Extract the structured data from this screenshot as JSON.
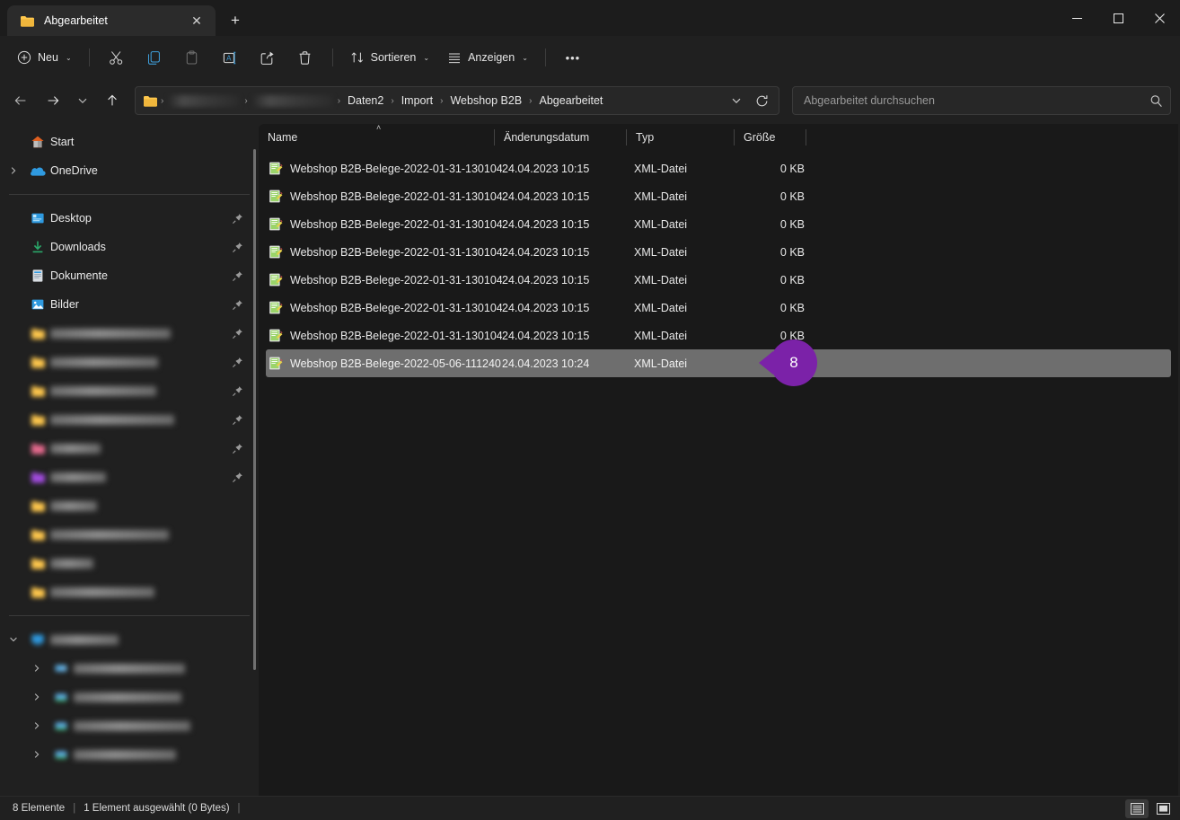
{
  "window": {
    "title": "Abgearbeitet",
    "controls": {
      "minimize": "minimize-icon",
      "maximize": "maximize-icon",
      "close": "close-icon"
    }
  },
  "tab": {
    "label": "Abgearbeitet",
    "close_label": "✕",
    "new_tab_label": "+"
  },
  "toolbar": {
    "new_label": "Neu",
    "sort_label": "Sortieren",
    "view_label": "Anzeigen",
    "more_label": "•••",
    "cut_name": "cut-icon",
    "copy_name": "copy-icon",
    "paste_name": "paste-icon",
    "rename_name": "rename-icon",
    "share_name": "share-icon",
    "delete_name": "delete-icon",
    "caret": "⌄"
  },
  "address": {
    "crumbs": [
      {
        "label": "",
        "redacted": true
      },
      {
        "label": "",
        "redacted": true
      },
      {
        "label": "Daten2",
        "redacted": false
      },
      {
        "label": "Import",
        "redacted": false
      },
      {
        "label": "Webshop B2B",
        "redacted": false
      },
      {
        "label": "Abgearbeitet",
        "redacted": false
      }
    ],
    "separator": "›",
    "dropdown_caret": "⌄",
    "refresh_name": "refresh-icon"
  },
  "search": {
    "placeholder": "Abgearbeitet durchsuchen",
    "value": ""
  },
  "sidebar": {
    "items": [
      {
        "label": "Start",
        "icon": "home-icon",
        "chevron": false,
        "pin": false,
        "redacted": false,
        "indent": 0
      },
      {
        "label": "OneDrive",
        "icon": "onedrive-icon",
        "chevron": true,
        "pin": false,
        "redacted": false,
        "indent": 0
      },
      {
        "divider": true
      },
      {
        "label": "Desktop",
        "icon": "desktop-icon",
        "chevron": false,
        "pin": true,
        "redacted": false,
        "indent": 0
      },
      {
        "label": "Downloads",
        "icon": "download-icon",
        "chevron": false,
        "pin": true,
        "redacted": false,
        "indent": 0
      },
      {
        "label": "Dokumente",
        "icon": "documents-icon",
        "chevron": false,
        "pin": true,
        "redacted": false,
        "indent": 0
      },
      {
        "label": "Bilder",
        "icon": "pictures-icon",
        "chevron": false,
        "pin": true,
        "redacted": false,
        "indent": 0
      },
      {
        "label": "",
        "icon": "folder-icon",
        "chevron": false,
        "pin": true,
        "redacted": true,
        "width": 134,
        "indent": 0
      },
      {
        "label": "",
        "icon": "folder-icon",
        "chevron": false,
        "pin": true,
        "redacted": true,
        "width": 120,
        "indent": 0
      },
      {
        "label": "",
        "icon": "folder-icon",
        "chevron": false,
        "pin": true,
        "redacted": true,
        "width": 118,
        "indent": 0
      },
      {
        "label": "",
        "icon": "folder-icon",
        "chevron": false,
        "pin": true,
        "redacted": true,
        "width": 138,
        "indent": 0
      },
      {
        "label": "",
        "icon": "pink-folder-icon",
        "chevron": false,
        "pin": true,
        "redacted": true,
        "width": 56,
        "indent": 0
      },
      {
        "label": "",
        "icon": "purple-folder-icon",
        "chevron": false,
        "pin": true,
        "redacted": true,
        "width": 62,
        "indent": 0
      },
      {
        "label": "",
        "icon": "folder-icon",
        "chevron": false,
        "pin": false,
        "redacted": true,
        "width": 52,
        "indent": 0
      },
      {
        "label": "",
        "icon": "folder-icon",
        "chevron": false,
        "pin": false,
        "redacted": true,
        "width": 132,
        "indent": 0
      },
      {
        "label": "",
        "icon": "folder-icon",
        "chevron": false,
        "pin": false,
        "redacted": true,
        "width": 48,
        "indent": 0
      },
      {
        "label": "",
        "icon": "folder-icon",
        "chevron": false,
        "pin": false,
        "redacted": true,
        "width": 116,
        "indent": 0
      },
      {
        "divider": true
      },
      {
        "label": "",
        "icon": "this-pc-icon",
        "chevron": true,
        "pin": false,
        "redacted": true,
        "width": 76,
        "indent": 0
      },
      {
        "label": "",
        "icon": "disk-icon",
        "chevron": true,
        "pin": false,
        "redacted": true,
        "width": 124,
        "indent": 1
      },
      {
        "label": "",
        "icon": "network-drive-icon",
        "chevron": true,
        "pin": false,
        "redacted": true,
        "width": 120,
        "indent": 1
      },
      {
        "label": "",
        "icon": "network-drive-icon",
        "chevron": true,
        "pin": false,
        "redacted": true,
        "width": 130,
        "indent": 1
      },
      {
        "label": "",
        "icon": "network-drive-icon",
        "chevron": true,
        "pin": false,
        "redacted": true,
        "width": 114,
        "indent": 1
      }
    ]
  },
  "filelist": {
    "columns": [
      {
        "key": "name",
        "label": "Name",
        "sorted": true,
        "sort_dir": "asc"
      },
      {
        "key": "date",
        "label": "Änderungsdatum"
      },
      {
        "key": "type",
        "label": "Typ"
      },
      {
        "key": "size",
        "label": "Größe"
      }
    ],
    "sort_glyph": "˄",
    "rows": [
      {
        "name": "Webshop B2B-Belege-2022-01-31-130104...",
        "date": "24.04.2023 10:15",
        "type": "XML-Datei",
        "size": "0 KB",
        "selected": false,
        "icon": "xml-file-icon"
      },
      {
        "name": "Webshop B2B-Belege-2022-01-31-130104...",
        "date": "24.04.2023 10:15",
        "type": "XML-Datei",
        "size": "0 KB",
        "selected": false,
        "icon": "xml-file-icon"
      },
      {
        "name": "Webshop B2B-Belege-2022-01-31-130104...",
        "date": "24.04.2023 10:15",
        "type": "XML-Datei",
        "size": "0 KB",
        "selected": false,
        "icon": "xml-file-icon"
      },
      {
        "name": "Webshop B2B-Belege-2022-01-31-130104...",
        "date": "24.04.2023 10:15",
        "type": "XML-Datei",
        "size": "0 KB",
        "selected": false,
        "icon": "xml-file-icon"
      },
      {
        "name": "Webshop B2B-Belege-2022-01-31-130104...",
        "date": "24.04.2023 10:15",
        "type": "XML-Datei",
        "size": "0 KB",
        "selected": false,
        "icon": "xml-file-icon"
      },
      {
        "name": "Webshop B2B-Belege-2022-01-31-130104...",
        "date": "24.04.2023 10:15",
        "type": "XML-Datei",
        "size": "0 KB",
        "selected": false,
        "icon": "xml-file-icon"
      },
      {
        "name": "Webshop B2B-Belege-2022-01-31-130104...",
        "date": "24.04.2023 10:15",
        "type": "XML-Datei",
        "size": "0 KB",
        "selected": false,
        "icon": "xml-file-icon"
      },
      {
        "name": "Webshop B2B-Belege-2022-05-06-111240...",
        "date": "24.04.2023 10:24",
        "type": "XML-Datei",
        "size": "",
        "selected": true,
        "icon": "xml-file-icon"
      }
    ],
    "annotation_badge": {
      "text": "8",
      "color": "#7b22a8"
    }
  },
  "statusbar": {
    "item_count": "8 Elemente",
    "selection": "1 Element ausgewählt (0 Bytes)",
    "separator": "|",
    "view_details_name": "details-view-icon",
    "view_icons_name": "large-icons-view-icon"
  },
  "colors": {
    "accent_badge": "#7b22a8",
    "selection_row": "#6e6e6e",
    "window_bg": "#202020",
    "pane_bg": "#191919"
  }
}
